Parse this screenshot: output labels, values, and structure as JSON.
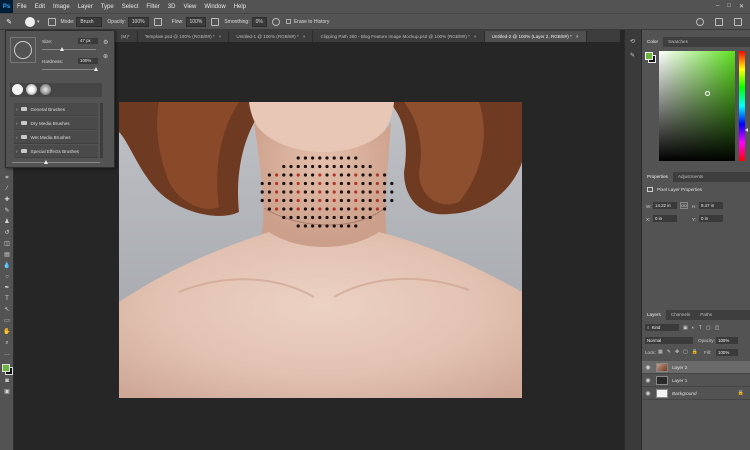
{
  "menu": {
    "app_logo": "Ps",
    "items": [
      "File",
      "Edit",
      "Image",
      "Layer",
      "Type",
      "Select",
      "Filter",
      "3D",
      "View",
      "Window",
      "Help"
    ]
  },
  "options": {
    "mode_label": "Mode:",
    "mode_value": "Brush",
    "opacity_label": "Opacity:",
    "opacity_value": "100%",
    "flow_label": "Flow:",
    "flow_value": "100%",
    "smoothing_label": "Smoothing:",
    "smoothing_value": "0%",
    "erase_label": "Erase to History"
  },
  "tabs": [
    {
      "label": "(M)*"
    },
    {
      "label": "Template.psd @ 100% (RGB/8#) *"
    },
    {
      "label": "Untitled-1 @ 100% (RGB/8#) *"
    },
    {
      "label": "Clipping Path 360 - Blog Feature Image Mockup.psd @ 100% (RGB/8#) *"
    },
    {
      "label": "Untitled-2 @ 100% (Layer 2, RGB/8#) *"
    }
  ],
  "brush_popup": {
    "size_label": "Size:",
    "size_value": "47 px",
    "hardness_label": "Hardness:",
    "hardness_value": "100%",
    "categories": [
      "General Brushes",
      "Dry Media Brushes",
      "Wet Media Brushes",
      "Special Effects Brushes"
    ]
  },
  "right": {
    "color_tabs": [
      "Color",
      "Swatches"
    ],
    "prop_tabs": [
      "Properties",
      "Adjustments"
    ],
    "prop_title": "Pixel Layer Properties",
    "w_label": "W:",
    "w_value": "14.22 in",
    "go_label": "GO",
    "h_label": "H:",
    "h_value": "9.47 in",
    "x_label": "X:",
    "x_value": "0 in",
    "y_label": "Y:",
    "y_value": "0 in",
    "layer_tabs": [
      "Layers",
      "Channels",
      "Paths"
    ],
    "kind_label": "Kind",
    "blend_mode": "Normal",
    "opacity_label": "Opacity:",
    "opacity_value": "100%",
    "lock_label": "Lock:",
    "fill_label": "Fill:",
    "fill_value": "100%",
    "layers": [
      {
        "name": "Layer 2"
      },
      {
        "name": "Layer 1"
      },
      {
        "name": "Background"
      }
    ]
  },
  "colors": {
    "foreground": "#6db33f",
    "hue_selected": "#5ee020"
  }
}
